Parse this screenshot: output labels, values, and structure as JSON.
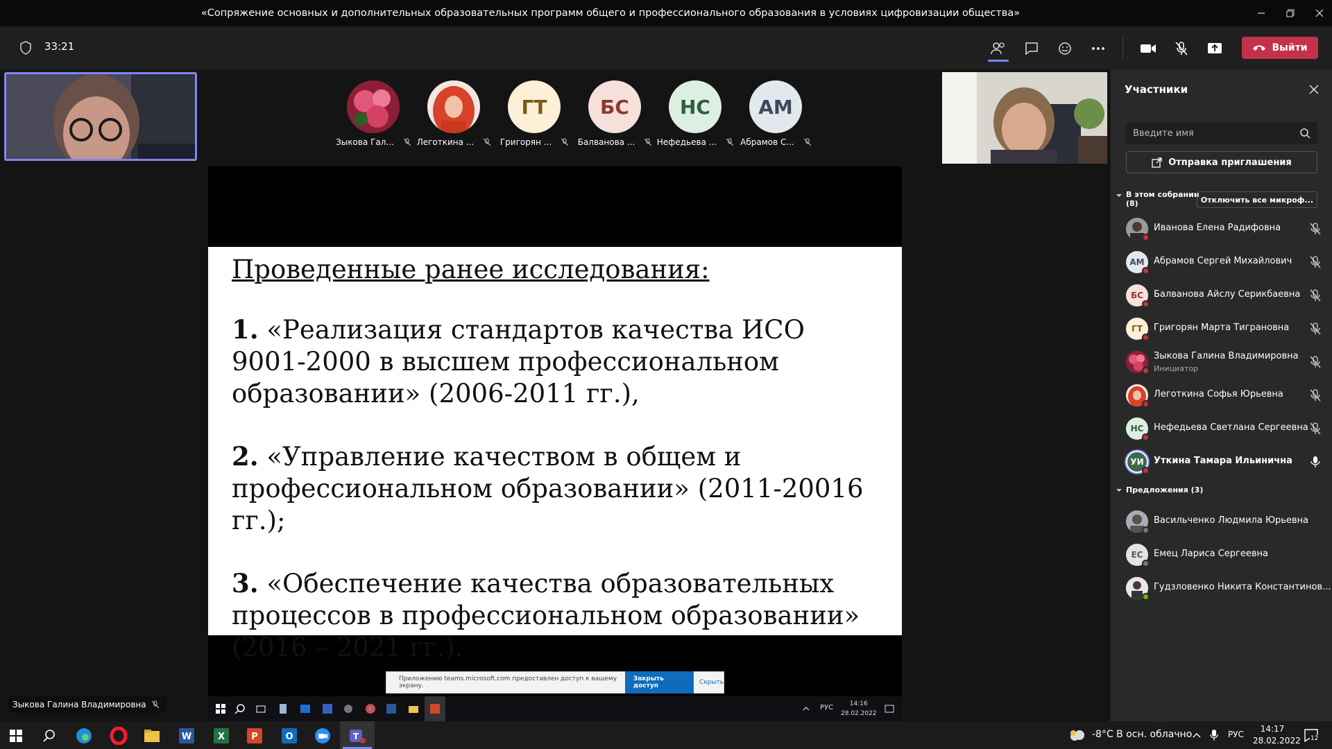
{
  "window": {
    "title": "«Сопряжение основных и дополнительных образовательных программ общего и профессионального образования в условиях цифровизации общества»"
  },
  "toolbar": {
    "timer": "33:21",
    "leave_label": "Выйти",
    "accent": "#c4314b"
  },
  "stage": {
    "video_tiles": [
      {
        "name": "Зыкова Гал...",
        "initials": "",
        "bg": "#b03a52",
        "photo": true
      },
      {
        "name": "Леготкина ...",
        "initials": "",
        "bg": "#d9532b",
        "photo": true
      },
      {
        "name": "Григорян ...",
        "initials": "ГТ",
        "bg": "#fdf0d7",
        "fg": "#7a5a1a"
      },
      {
        "name": "Балванова ...",
        "initials": "БС",
        "bg": "#f7e0db",
        "fg": "#8a3c2c"
      },
      {
        "name": "Нефедьева ...",
        "initials": "НС",
        "bg": "#ddeee3",
        "fg": "#2f5e3d"
      },
      {
        "name": "Абрамов С...",
        "initials": "АМ",
        "bg": "#e2e8ee",
        "fg": "#3c4a5a"
      }
    ],
    "presenter_label": "Зыкова Галина Владимировна"
  },
  "slide": {
    "heading": "Проведенные ранее исследования:",
    "items": [
      {
        "num": "1.",
        "text": " «Реализация стандартов качества ИСО 9001-2000 в высшем профессиональном образовании» (2006-2011 гг.),"
      },
      {
        "num": "2.",
        "text": " «Управление качеством в общем и профессиональном образовании» (2011-20016 гг.);"
      },
      {
        "num": "3.",
        "text": " «Обеспечение качества образовательных процессов в профессиональном образовании» (2016 – 2021 гг.)."
      }
    ]
  },
  "share_banner": {
    "message": "Приложению teams.microsoft.com предоставлен доступ к вашему экрану.",
    "stop_label": "Закрыть доступ",
    "hide_label": "Скрыть"
  },
  "inner_taskbar": {
    "lang": "РУС",
    "time": "14:16",
    "date": "28.02.2022"
  },
  "panel": {
    "title": "Участники",
    "search_placeholder": "Введите имя",
    "invite_label": "Отправка приглашения",
    "in_meeting_label": "В этом собрании",
    "in_meeting_count": "(8)",
    "mute_all_label": "Отключить все микроф...",
    "participants": [
      {
        "name": "Иванова Елена Радифовна",
        "sub": "",
        "initials": "",
        "bg": "#6b6b6b",
        "fg": "#fff",
        "dot": "#c4314b",
        "photo": true,
        "mic": "muted"
      },
      {
        "name": "Абрамов Сергей Михайлович",
        "sub": "",
        "initials": "АМ",
        "bg": "#e2e8ee",
        "fg": "#3c4a5a",
        "dot": "#c4314b",
        "mic": "muted"
      },
      {
        "name": "Балванова Айслу Серикбаевна",
        "sub": "",
        "initials": "БС",
        "bg": "#f7e0db",
        "fg": "#8a3c2c",
        "dot": "#c4314b",
        "mic": "muted"
      },
      {
        "name": "Григорян Марта Тиграновна",
        "sub": "",
        "initials": "ГТ",
        "bg": "#fdf0d7",
        "fg": "#7a5a1a",
        "dot": "#c4314b",
        "mic": "muted"
      },
      {
        "name": "Зыкова Галина Владимировна",
        "sub": "Инициатор",
        "initials": "",
        "bg": "#b03a52",
        "fg": "#fff",
        "dot": "#c4314b",
        "photo": true,
        "mic": "muted"
      },
      {
        "name": "Леготкина Софья Юрьевна",
        "sub": "",
        "initials": "",
        "bg": "#d9532b",
        "fg": "#fff",
        "dot": "#c4314b",
        "photo": true,
        "mic": "muted"
      },
      {
        "name": "Нефедьева Светлана Сергеевна",
        "sub": "",
        "initials": "НС",
        "bg": "#ddeee3",
        "fg": "#2f5e3d",
        "dot": "#c4314b",
        "mic": "muted"
      },
      {
        "name": "Уткина Тамара Ильинична",
        "sub": "",
        "initials": "УИ",
        "bg": "#3a6b4a",
        "fg": "#fff",
        "dot": "#c4314b",
        "ring": true,
        "mic": "on"
      }
    ],
    "suggestions_label": "Предложения (3)",
    "suggestions": [
      {
        "name": "Васильченко Людмила Юрьевна",
        "initials": "",
        "bg": "#8a8f96",
        "fg": "#fff",
        "dot": "#777",
        "photo": true
      },
      {
        "name": "Емец Лариса Сергеевна",
        "initials": "ЕС",
        "bg": "#e4e4e4",
        "fg": "#555",
        "dot": "#777"
      },
      {
        "name": "Гудзловенко Никита Константинов...",
        "initials": "",
        "bg": "#cfcfcf",
        "fg": "#333",
        "dot": "#6bb700",
        "photo": true
      }
    ]
  },
  "taskbar": {
    "weather": "-8°C  В осн. облачно",
    "lang": "РУС",
    "time": "14:17",
    "date": "28.02.2022",
    "notifications": "12"
  }
}
